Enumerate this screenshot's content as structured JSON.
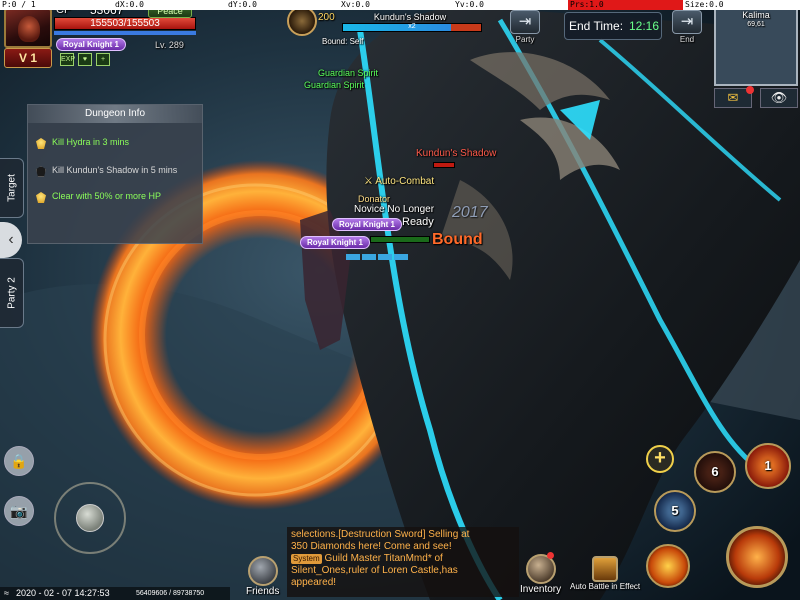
{
  "debug": {
    "p": "P:0 / 1",
    "dx": "dX:0.0",
    "dy": "dY:0.0",
    "xv": "Xv:0.0",
    "yv": "Yv:0.0",
    "prs": "Prs:1.0",
    "size": "Size:0.0"
  },
  "player": {
    "cp_label": "CP",
    "cp_value": "53067",
    "mode_label": "Peace",
    "hp_text": "155503/155503",
    "hp_fraction": 1.0,
    "title_badge": "Royal Knight 1",
    "level_text": "Lv. 289",
    "vip_level": "V 1",
    "buffs": [
      "EXP",
      "heart-icon",
      "plus-icon"
    ]
  },
  "boss": {
    "level": "200",
    "name": "Kundun's Shadow",
    "stack": "x2",
    "status": "Bound: Self",
    "hp_fraction": 0.8
  },
  "top_right": {
    "party_label": "Party",
    "end_time_label": "End Time:",
    "end_time_value": "12:16",
    "end_label": "End",
    "map_name": "Kalima",
    "map_coords": "69,61",
    "mail_icon": "mail-icon",
    "eye_icon": "eye-icon"
  },
  "side_tabs": {
    "target": "Target",
    "party": "Party 2"
  },
  "dungeon": {
    "title": "Dungeon Info",
    "quests": [
      {
        "text": "Kill Hydra in 3 mins",
        "done": true,
        "color": "#8cff5a"
      },
      {
        "text": "Kill Kundun's Shadow in 5 mins",
        "done": false,
        "color": "#d8d8d8"
      },
      {
        "text": "Clear with 50% or more HP",
        "done": true,
        "color": "#8cff5a"
      }
    ]
  },
  "floating": {
    "guardian_1": "Guardian Spirit",
    "guardian_2": "Guardian Spirit",
    "boss_overhead": "Kundun's Shadow",
    "auto_combat": "Auto-Combat",
    "donator": "Donator",
    "novice": "Novice No Longer",
    "ready": "Ready",
    "bound": "Bound",
    "title_1": "Royal Knight 1",
    "title_2": "Royal Knight 1",
    "watermark": "2017"
  },
  "chat": {
    "line1": "selections.[Destruction Sword]  Selling at",
    "line2": "350 Diamonds here! Come and see!",
    "system_tag": "System",
    "line3": "Guild Master TitanMmd* of",
    "line4": "Silent_Ones,ruler of Loren Castle,has",
    "line5": "appeared!"
  },
  "bottom": {
    "friends": "Friends",
    "inventory": "Inventory",
    "auto_battle": "Auto Battle in Effect"
  },
  "skills": {
    "cd_6": "6",
    "cd_1": "1",
    "cd_5": "5"
  },
  "footer": {
    "datetime": "2020 - 02 - 07 14:27:53",
    "ids": "56409606 / 89738750"
  },
  "colors": {
    "hp": "#c81e14",
    "boss_hp": "#1ab8e8",
    "end_time": "#6aff8a",
    "quest_done": "#8cff5a",
    "fire": "#ff7a1a",
    "cyan_accent": "#2ee0ff"
  }
}
